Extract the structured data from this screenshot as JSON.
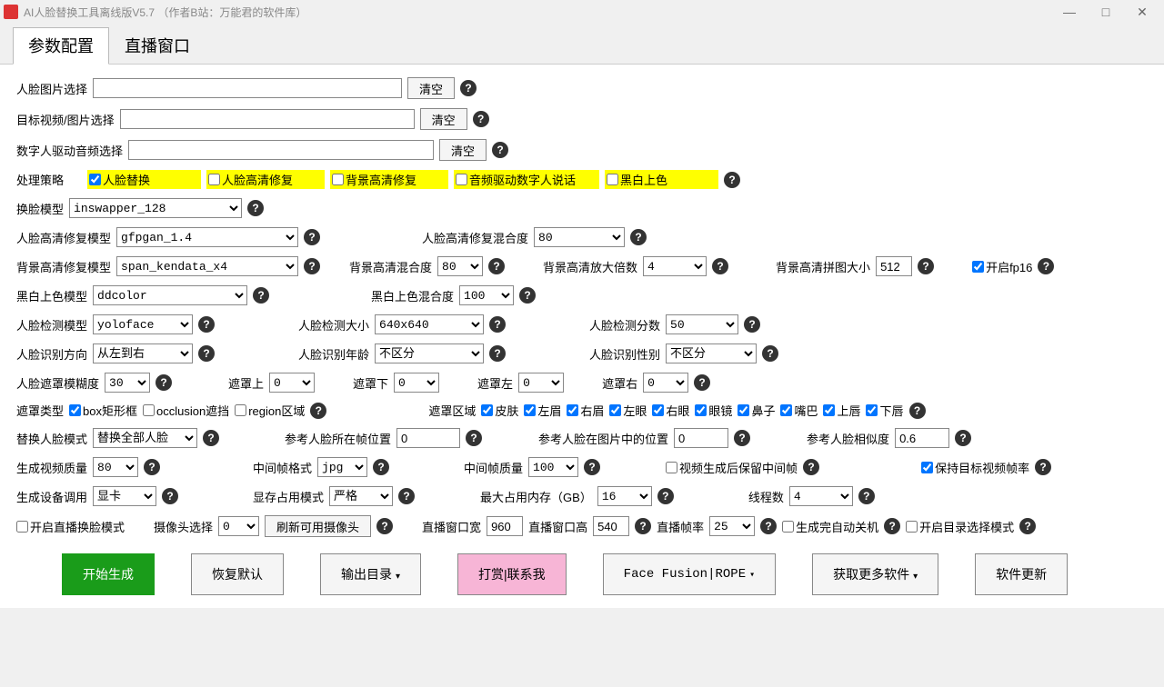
{
  "title": "AI人脸替换工具离线版V5.7  （作者B站：万能君的软件库）",
  "tabs": {
    "config": "参数配置",
    "live": "直播窗口"
  },
  "r1": {
    "lbl": "人脸图片选择",
    "clear": "清空"
  },
  "r2": {
    "lbl": "目标视频/图片选择",
    "clear": "清空"
  },
  "r3": {
    "lbl": "数字人驱动音频选择",
    "clear": "清空"
  },
  "strategy": {
    "lbl": "处理策略",
    "o1": "人脸替换",
    "o2": "人脸高清修复",
    "o3": "背景高清修复",
    "o4": "音频驱动数字人说话",
    "o5": "黑白上色"
  },
  "swap": {
    "lbl": "换脸模型",
    "val": "inswapper_128"
  },
  "faceHQ": {
    "lbl": "人脸高清修复模型",
    "val": "gfpgan_1.4",
    "blendLbl": "人脸高清修复混合度",
    "blend": "80"
  },
  "bgHQ": {
    "lbl": "背景高清修复模型",
    "val": "span_kendata_x4",
    "blendLbl": "背景高清混合度",
    "blend": "80",
    "scaleLbl": "背景高清放大倍数",
    "scale": "4",
    "tileLbl": "背景高清拼图大小",
    "tile": "512",
    "fp16": "开启fp16"
  },
  "bw": {
    "lbl": "黑白上色模型",
    "val": "ddcolor",
    "blendLbl": "黑白上色混合度",
    "blend": "100"
  },
  "detect": {
    "lbl": "人脸检测模型",
    "val": "yoloface",
    "sizeLbl": "人脸检测大小",
    "size": "640x640",
    "scoreLbl": "人脸检测分数",
    "score": "50"
  },
  "recog": {
    "dirLbl": "人脸识别方向",
    "dir": "从左到右",
    "ageLbl": "人脸识别年龄",
    "age": "不区分",
    "genderLbl": "人脸识别性别",
    "gender": "不区分"
  },
  "mask": {
    "blurLbl": "人脸遮罩模糊度",
    "blur": "30",
    "topLbl": "遮罩上",
    "top": "0",
    "botLbl": "遮罩下",
    "bot": "0",
    "leftLbl": "遮罩左",
    "left": "0",
    "rightLbl": "遮罩右",
    "right": "0",
    "typeLbl": "遮罩类型",
    "t1": "box矩形框",
    "t2": "occlusion遮挡",
    "t3": "region区域",
    "areaLbl": "遮罩区域",
    "a1": "皮肤",
    "a2": "左眉",
    "a3": "右眉",
    "a4": "左眼",
    "a5": "右眼",
    "a6": "眼镜",
    "a7": "鼻子",
    "a8": "嘴巴",
    "a9": "上唇",
    "a10": "下唇"
  },
  "ref": {
    "modeLbl": "替换人脸模式",
    "mode": "替换全部人脸",
    "frameLbl": "参考人脸所在帧位置",
    "frame": "0",
    "posLbl": "参考人脸在图片中的位置",
    "pos": "0",
    "simLbl": "参考人脸相似度",
    "sim": "0.6"
  },
  "video": {
    "qLbl": "生成视频质量",
    "q": "80",
    "fmtLbl": "中间帧格式",
    "fmt": "jpg",
    "fqLbl": "中间帧质量",
    "fq": "100",
    "keep": "视频生成后保留中间帧",
    "fps": "保持目标视频帧率"
  },
  "device": {
    "lbl": "生成设备调用",
    "val": "显卡",
    "vramLbl": "显存占用模式",
    "vram": "严格",
    "memLbl": "最大占用内存（GB）",
    "mem": "16",
    "thrLbl": "线程数",
    "thr": "4"
  },
  "live": {
    "enable": "开启直播换脸模式",
    "camLbl": "摄像头选择",
    "cam": "0",
    "refresh": "刷新可用摄像头",
    "wLbl": "直播窗口宽",
    "w": "960",
    "hLbl": "直播窗口高",
    "h": "540",
    "fpsLbl": "直播帧率",
    "fpsv": "25",
    "autoOff": "生成完自动关机",
    "dirMode": "开启目录选择模式"
  },
  "btns": {
    "start": "开始生成",
    "reset": "恢复默认",
    "outdir": "输出目录",
    "donate": "打赏|联系我",
    "fusion": "Face Fusion|ROPE",
    "more": "获取更多软件",
    "update": "软件更新"
  }
}
